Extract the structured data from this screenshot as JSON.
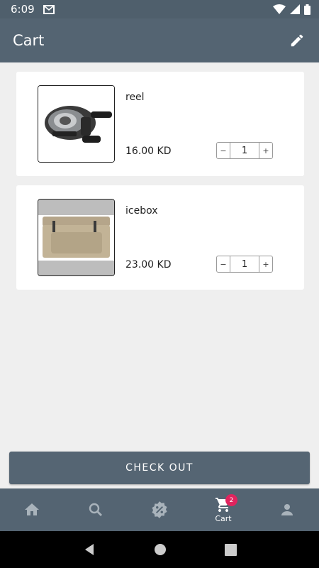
{
  "status_bar": {
    "time": "6:09"
  },
  "app_bar": {
    "title": "Cart"
  },
  "cart": {
    "items": [
      {
        "name": "reel",
        "price": "16.00 KD",
        "quantity": "1",
        "minus": "−",
        "plus": "+"
      },
      {
        "name": "icebox",
        "price": "23.00 KD",
        "quantity": "1",
        "minus": "−",
        "plus": "+"
      }
    ]
  },
  "checkout": {
    "label": "CHECK OUT"
  },
  "bottom_nav": {
    "items": [
      {
        "icon": "home-icon"
      },
      {
        "icon": "search-icon"
      },
      {
        "icon": "discount-icon"
      },
      {
        "icon": "cart-icon",
        "label": "Cart",
        "badge": "2"
      },
      {
        "icon": "account-icon"
      }
    ]
  },
  "colors": {
    "primary": "#546472",
    "badge": "#e0245e",
    "background": "#efefef"
  }
}
